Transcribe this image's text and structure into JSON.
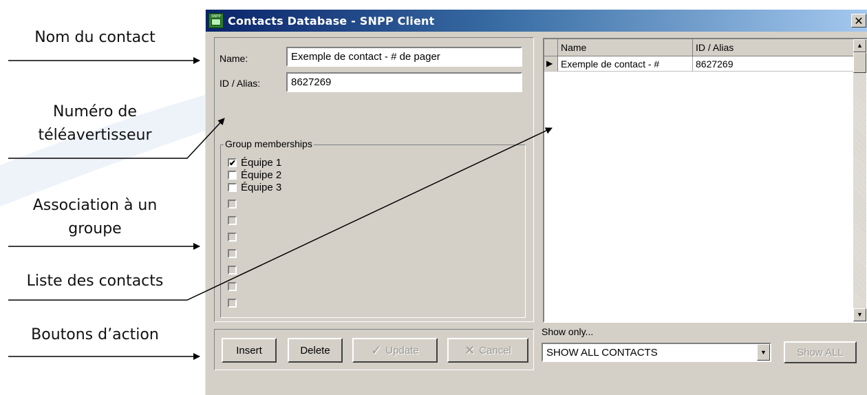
{
  "annotations": [
    {
      "text": "Nom du contact"
    },
    {
      "text": "Numéro de"
    },
    {
      "text": "téléavertisseur"
    },
    {
      "text": "Association à un"
    },
    {
      "text": "groupe"
    },
    {
      "text": "Liste des contacts"
    },
    {
      "text": "Boutons d’action"
    }
  ],
  "window": {
    "icon_text": "SNPP",
    "title": "Contacts Database  -  SNPP Client",
    "close_glyph": "✕"
  },
  "form": {
    "name_label": "Name:",
    "name_value": "Exemple de contact - # de pager",
    "id_label": "ID / Alias:",
    "id_value": "8627269"
  },
  "groups": {
    "title": "Group memberships",
    "items": [
      {
        "label": "Équipe 1",
        "checked": true,
        "mark": "✔"
      },
      {
        "label": "Équipe 2",
        "checked": false,
        "mark": ""
      },
      {
        "label": "Équipe 3",
        "checked": false,
        "mark": ""
      }
    ]
  },
  "contacts_grid": {
    "columns": [
      "Name",
      "ID / Alias"
    ],
    "rows": [
      {
        "indicator": "▶",
        "name": "Exemple de contact - #",
        "id": "8627269"
      }
    ]
  },
  "buttons": {
    "insert": "Insert",
    "delete": "Delete",
    "update": "Update",
    "cancel": "Cancel",
    "update_icon": "check-icon",
    "cancel_icon": "x-icon"
  },
  "filter": {
    "label": "Show only...",
    "value": "SHOW ALL CONTACTS",
    "show_all": "Show ALL"
  },
  "scroll_glyphs": {
    "up": "▲",
    "down": "▼"
  },
  "colors": {
    "titlebar_start": "#0a246a",
    "titlebar_end": "#a6caf0",
    "window_bg": "#d4d0c8"
  }
}
